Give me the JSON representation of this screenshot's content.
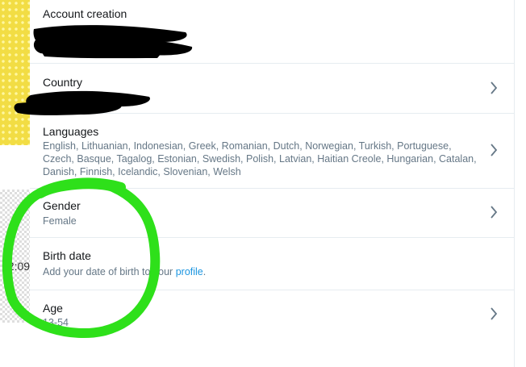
{
  "rows": {
    "account_creation": {
      "title": "Account creation"
    },
    "country": {
      "title": "Country"
    },
    "languages": {
      "title": "Languages",
      "line1": "English, Lithuanian, Indonesian, Greek, Romanian, Dutch, Norwegian, Turkish, Portuguese,",
      "line2": "Czech, Basque, Tagalog, Estonian, Swedish, Polish, Latvian, Haitian Creole, Hungarian, Catalan,",
      "line3": "Danish, Finnish, Icelandic, Slovenian, Welsh"
    },
    "gender": {
      "title": "Gender",
      "value": "Female"
    },
    "birth_date": {
      "title": "Birth date",
      "text_before": "Add your date of birth to your",
      "link": "profile",
      "text_after": "."
    },
    "age": {
      "title": "Age",
      "value": "13-54"
    }
  },
  "sidebar": {
    "time": "12:09"
  },
  "colors": {
    "accent": "#1b95e0",
    "annotation": "#2ee01a",
    "redaction": "#000000"
  },
  "icons": {
    "chevron": "chevron-right-icon"
  }
}
